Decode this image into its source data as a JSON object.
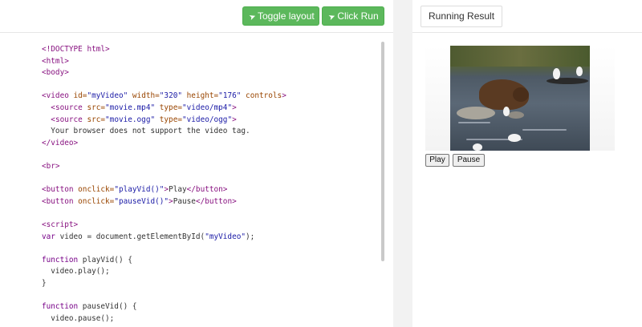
{
  "toolbar": {
    "toggle_label": "Toggle layout",
    "run_label": "Click Run"
  },
  "code_lines": [
    [
      {
        "t": "tag",
        "v": "<!DOCTYPE html>"
      }
    ],
    [
      {
        "t": "tag",
        "v": "<html>"
      }
    ],
    [
      {
        "t": "tag",
        "v": "<body>"
      }
    ],
    [],
    [
      {
        "t": "tag",
        "v": "<video "
      },
      {
        "t": "attr",
        "v": "id="
      },
      {
        "t": "str",
        "v": "\"myVideo\""
      },
      {
        "t": "attr",
        "v": " width="
      },
      {
        "t": "str",
        "v": "\"320\""
      },
      {
        "t": "attr",
        "v": " height="
      },
      {
        "t": "str",
        "v": "\"176\""
      },
      {
        "t": "attr",
        "v": " controls"
      },
      {
        "t": "tag",
        "v": ">"
      }
    ],
    [
      {
        "t": "plain",
        "v": "  "
      },
      {
        "t": "tag",
        "v": "<source "
      },
      {
        "t": "attr",
        "v": "src="
      },
      {
        "t": "str",
        "v": "\"movie.mp4\""
      },
      {
        "t": "attr",
        "v": " type="
      },
      {
        "t": "str",
        "v": "\"video/mp4\""
      },
      {
        "t": "tag",
        "v": ">"
      }
    ],
    [
      {
        "t": "plain",
        "v": "  "
      },
      {
        "t": "tag",
        "v": "<source "
      },
      {
        "t": "attr",
        "v": "src="
      },
      {
        "t": "str",
        "v": "\"movie.ogg\""
      },
      {
        "t": "attr",
        "v": " type="
      },
      {
        "t": "str",
        "v": "\"video/ogg\""
      },
      {
        "t": "tag",
        "v": ">"
      }
    ],
    [
      {
        "t": "plain",
        "v": "  Your browser does not support the video tag."
      }
    ],
    [
      {
        "t": "tag",
        "v": "</video>"
      }
    ],
    [],
    [
      {
        "t": "tag",
        "v": "<br>"
      }
    ],
    [],
    [
      {
        "t": "tag",
        "v": "<button "
      },
      {
        "t": "attr",
        "v": "onclick="
      },
      {
        "t": "str",
        "v": "\"playVid()\""
      },
      {
        "t": "tag",
        "v": ">"
      },
      {
        "t": "plain",
        "v": "Play"
      },
      {
        "t": "tag",
        "v": "</button>"
      }
    ],
    [
      {
        "t": "tag",
        "v": "<button "
      },
      {
        "t": "attr",
        "v": "onclick="
      },
      {
        "t": "str",
        "v": "\"pauseVid()\""
      },
      {
        "t": "tag",
        "v": ">"
      },
      {
        "t": "plain",
        "v": "Pause"
      },
      {
        "t": "tag",
        "v": "</button>"
      }
    ],
    [],
    [
      {
        "t": "tag",
        "v": "<script>"
      }
    ],
    [
      {
        "t": "kw",
        "v": "var"
      },
      {
        "t": "plain",
        "v": " video = document.getElementById("
      },
      {
        "t": "str",
        "v": "\"myVideo\""
      },
      {
        "t": "plain",
        "v": ");"
      }
    ],
    [],
    [
      {
        "t": "kw",
        "v": "function"
      },
      {
        "t": "plain",
        "v": " playVid() {"
      }
    ],
    [
      {
        "t": "plain",
        "v": "  video.play();"
      }
    ],
    [
      {
        "t": "plain",
        "v": "}"
      }
    ],
    [],
    [
      {
        "t": "kw",
        "v": "function"
      },
      {
        "t": "plain",
        "v": " pauseVid() {"
      }
    ],
    [
      {
        "t": "plain",
        "v": "  video.pause();"
      }
    ]
  ],
  "result": {
    "title": "Running Result",
    "play_label": "Play",
    "pause_label": "Pause"
  }
}
